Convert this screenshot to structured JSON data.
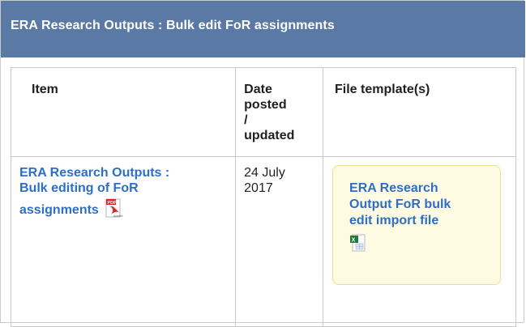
{
  "panel": {
    "title": "ERA Research Outputs : Bulk edit FoR assignments"
  },
  "table": {
    "headers": {
      "item": "Item",
      "date_line1": "Date",
      "date_line2": "posted",
      "date_line3": "/",
      "date_line4": "updated",
      "templates": "File template(s)"
    },
    "rows": [
      {
        "item_line1": "ERA Research Outputs :",
        "item_line2": "Bulk editing of FoR",
        "item_line3": "assignments",
        "item_icon": "pdf-icon",
        "date_line1": "24 July",
        "date_line2": "2017",
        "template_line1": "ERA Research",
        "template_line2": "Output FoR bulk",
        "template_line3": "edit import file",
        "template_icon": "excel-icon"
      }
    ]
  },
  "colors": {
    "header_bg": "#5a7aa5",
    "link": "#2d6fc6",
    "template_box_bg": "#fffbe3",
    "template_box_border": "#f2dd8a"
  }
}
